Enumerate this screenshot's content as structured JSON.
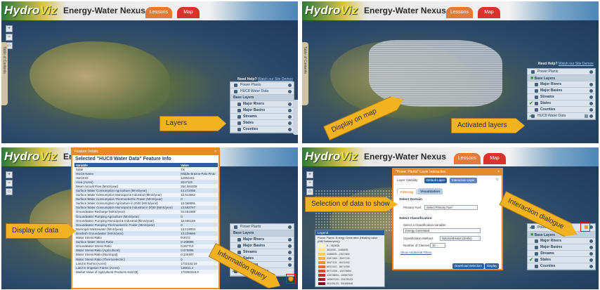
{
  "app": {
    "logo_prefix": "Hydro",
    "logo_suffix": "Viz",
    "title": "Energy-Water Nexus",
    "tabs": [
      "Lessons",
      "Map"
    ],
    "table_of_contents": "Table of Contents",
    "zoom_in": "+",
    "zoom_out": "−",
    "zoom_home": "⌂",
    "layers_tab": "Layers"
  },
  "help": {
    "prefix": "Need Help?",
    "link": "Watch our Site Demos"
  },
  "layers_panel": {
    "power_plants": "Power Plants",
    "huc8_water_data": "HUC8 Water Data",
    "base_layers": "Base Layers",
    "major_rivers": "Major Rivers",
    "major_basins": "Major Basins",
    "streams": "Streams",
    "states": "States",
    "counties": "Counties"
  },
  "panel1": {
    "callout": "Layers"
  },
  "panel2": {
    "callout_map": "Display on map",
    "callout_layers": "Activated layers"
  },
  "panel3": {
    "window_bar": "Feature Details",
    "window_title": "Selected \"HUC8 Water Data\" Feature Info",
    "col_variable": "Variable",
    "col_value": "Value",
    "rows": [
      [
        "State",
        "TX"
      ],
      [
        "HUC8 Name",
        "Middle Brazos-Palo Pinto"
      ],
      [
        "HUC8 ID",
        "12060201"
      ],
      [
        "Area (Acres)",
        "2017115"
      ],
      [
        "Mean Annual Flow (MmS/year)",
        "254.084408"
      ],
      [
        "Surface Water Consumption Agriculture (MmS/year)",
        "13.272068"
      ],
      [
        "Surface Water Consumption Municipal & Industrial (MmS/year)",
        "12.913662"
      ],
      [
        "Surface Water Consumption Thermoelectric Power (MmS/year)",
        "0"
      ],
      [
        "Surface Water Consumption Agriculture in 2030 (MmS/year)",
        "13.068891"
      ],
      [
        "Surface Water Consumption Municipal & Industrial in 2030 (MmS/year)",
        "13.582767"
      ],
      [
        "Groundwater Recharge (MmS/year)",
        "34.481989"
      ],
      [
        "Groundwater Pumping Agriculture (MmS/year)",
        "0"
      ],
      [
        "Groundwater Pumping Municipal & Industrial (MmS/year)",
        "12.606169"
      ],
      [
        "Groundwater Pumping Thermoelectric Power (MmS/year)",
        "0"
      ],
      [
        "Municipal Wastewater (MmS/year)",
        "13.219004"
      ],
      [
        "Brackish Groundwater (MmS/year)",
        "13.229666"
      ],
      [
        "Water Stress Ratio",
        "0.2072"
      ],
      [
        "Surface Water Stress Ratio",
        "0.188898"
      ],
      [
        "Groundwater Stress Ratio",
        "0.267714"
      ],
      [
        "Water Stress Ratio (Agricultural)",
        "0.070895"
      ],
      [
        "Water Stress Ratio (Municipal)",
        "0.130307"
      ],
      [
        "Water Stress Ratio (Thermoelectric)",
        "0"
      ],
      [
        "Land in Farms (Acres)",
        "1732133.19"
      ],
      [
        "Land in Irrigation Farms (Acres)",
        "135511.4"
      ],
      [
        "Market Value of Agricultural Products Sold ($)",
        "172282223.8"
      ]
    ],
    "callout_data": "Display of data",
    "callout_query": "Information query"
  },
  "panel4": {
    "dialog_bar": "\"Power Plants\" Layer Interaction",
    "layer_visibility": "Layer Visibility:",
    "default_layer": "Default Layer",
    "interaction_layer": "Interaction Layer",
    "tab_filtering": "Filtering",
    "tab_visualization": "Visualization",
    "select_domain": "Select Domain",
    "primary_fuel_label": "Primary Fuel:",
    "primary_fuel_value": "Select Primary Fuel",
    "select_classification": "Select Classification",
    "class_var_label": "Select a Classification Variable:",
    "class_var_value": "Energy Generated",
    "class_method_label": "Classification Method:",
    "class_method_value": "Natural Breaks (Jenks)",
    "num_classes_label": "Number of Classes:",
    "num_classes_value": "10",
    "show_filters": "Show Additional Filters",
    "download_button": "Download Selection",
    "display_button": "Display",
    "legend_header": "Legend",
    "legend_title": "Power Plants: Energy Generated (Heating value (MM British/year))",
    "legend_items": [
      "0 - 362835",
      "362835 - 1186835",
      "1186835 - 2347484",
      "2347484 - 3947131",
      "3947131 - 6021192",
      "6021192 - 8971936",
      "8971936 - 12878894",
      "12878894 - 18587020",
      "18587020 - 25105123",
      "25105123 - 35085948"
    ],
    "legend_colors": [
      "#fff5c0",
      "#fde58a",
      "#fccf5a",
      "#fbb044",
      "#f78e36",
      "#f06a2b",
      "#e2452a",
      "#c92a2a",
      "#a8162a",
      "#7a0a24"
    ],
    "callout_selection": "Selection of data to show",
    "callout_dialogue": "Interaction dialogue"
  }
}
